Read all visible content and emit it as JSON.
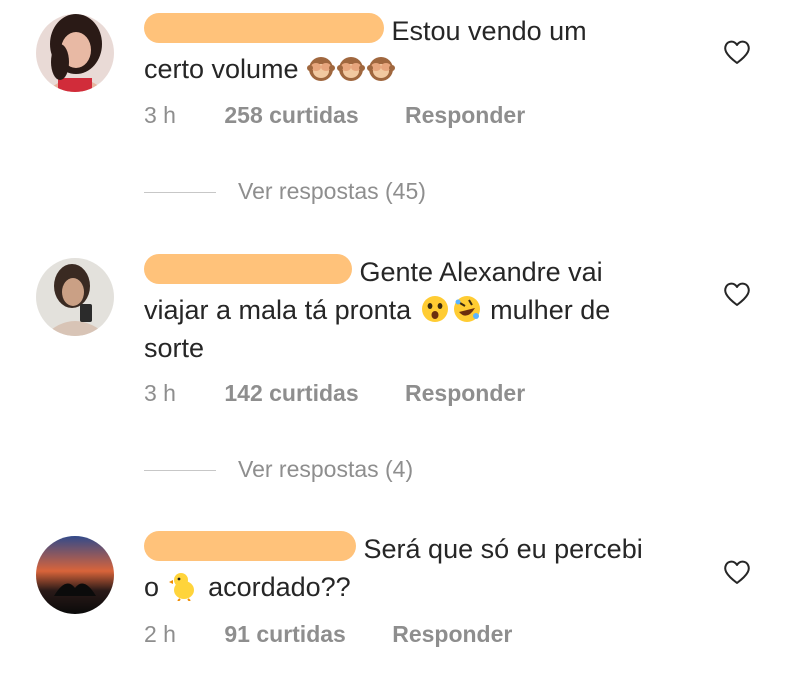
{
  "comments": [
    {
      "text_line1": "Estou vendo um",
      "text_line2": "certo volume",
      "emojis": [
        "see-no-evil-monkey",
        "see-no-evil-monkey",
        "see-no-evil-monkey"
      ],
      "time": "3 h",
      "likes": "258 curtidas",
      "reply": "Responder",
      "view_replies": "Ver respostas (45)"
    },
    {
      "text_line1": "Gente Alexandre vai",
      "text_line2a": "viajar a mala tá pronta",
      "text_line2b": "mulher de",
      "text_line3": "sorte",
      "emojis": [
        "astonished-face",
        "rolling-on-floor-laughing"
      ],
      "time": "3 h",
      "likes": "142 curtidas",
      "reply": "Responder",
      "view_replies": "Ver respostas (4)"
    },
    {
      "text_line1": "Será que só eu percebi",
      "text_line2a": "o",
      "text_line2b": "acordado??",
      "emojis": [
        "baby-chick"
      ],
      "time": "2 h",
      "likes": "91 curtidas",
      "reply": "Responder"
    }
  ],
  "colors": {
    "text": "#262626",
    "meta": "#8e8e8e",
    "redaction": "#ffc27a"
  },
  "icons": [
    "heart-outline-icon"
  ]
}
